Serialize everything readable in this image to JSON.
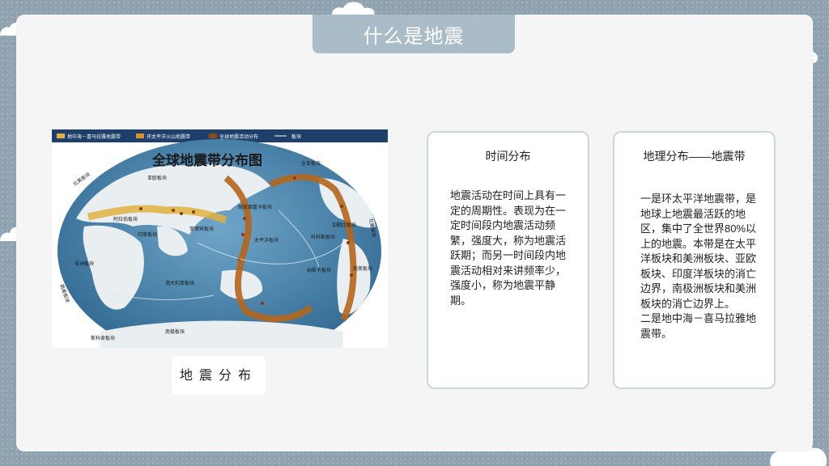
{
  "slide": {
    "title": "什么是地震",
    "map_caption": "地震分布"
  },
  "map": {
    "title": "全球地震带分布图",
    "legend": [
      "地中海－喜马拉雅地震带",
      "环太平洋火山地震带",
      "全球地震活动分布",
      "板块"
    ],
    "plates": [
      "北美板块",
      "亚欧板块",
      "阿拉伯板块",
      "印度板块",
      "非洲板块",
      "南美板块",
      "菲律宾板块",
      "胡安德富卡板块",
      "太平洋板块",
      "科科斯板块",
      "纳斯卡板块",
      "澳大利亚板块",
      "南极板块",
      "斯科舍板块",
      "加勒比板块",
      "北美板块",
      "南美板块",
      "全亚板块"
    ],
    "colors": {
      "ocean": "#3f7aa3",
      "land": "#e9eef0",
      "belt_pacific": "#b5651d",
      "belt_med": "#e0b040",
      "legend_bar": "#1f3f6b"
    }
  },
  "panels": {
    "time": {
      "heading": "时间分布",
      "body": "地震活动在时间上具有一定的周期性。表现为在一定时间段内地震活动频繁，强度大，称为地震活跃期；而另一时间段内地震活动相对来讲频率少，强度小，称为地震平静期。"
    },
    "geo": {
      "heading": "地理分布——地震带",
      "body": "一是环太平洋地震带，是地球上地震最活跃的地区，集中了全世界80%以上的地震。本带是在太平洋板块和美洲板块、亚欧板块、印度洋板块的消亡边界，南极洲板块和美洲板块的消亡边界上。\n二是地中海－喜马拉雅地震带。"
    }
  }
}
